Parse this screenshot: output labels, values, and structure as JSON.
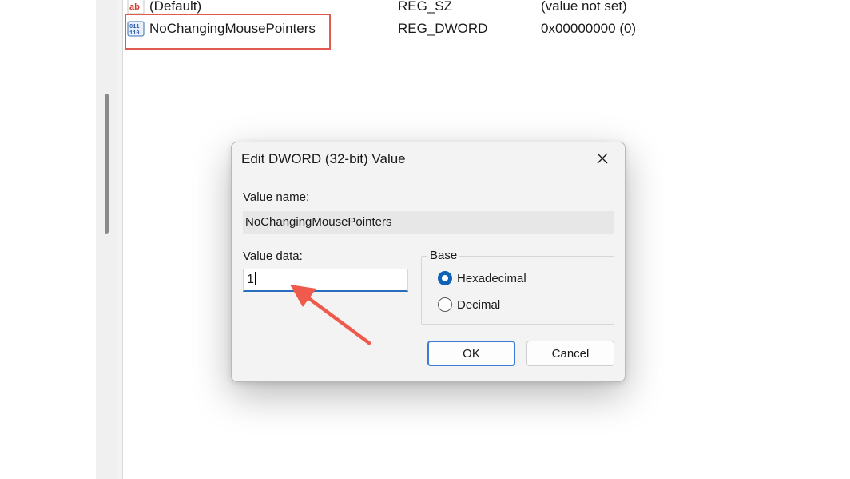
{
  "registry_list": {
    "rows": [
      {
        "name": "(Default)",
        "type": "REG_SZ",
        "data": "(value not set)",
        "icon": "string-value-icon"
      },
      {
        "name": "NoChangingMousePointers",
        "type": "REG_DWORD",
        "data": "0x00000000 (0)",
        "icon": "dword-value-icon"
      }
    ]
  },
  "dialog": {
    "title": "Edit DWORD (32-bit) Value",
    "value_name_label": "Value name:",
    "value_name": "NoChangingMousePointers",
    "value_data_label": "Value data:",
    "value_data": "1",
    "base_label": "Base",
    "base_options": [
      {
        "label": "Hexadecimal",
        "selected": true
      },
      {
        "label": "Decimal",
        "selected": false
      }
    ],
    "ok_label": "OK",
    "cancel_label": "Cancel"
  },
  "colors": {
    "highlight_box": "#e05a4f",
    "annotation_arrow": "#ef5a4c",
    "accent": "#0f62b8"
  }
}
